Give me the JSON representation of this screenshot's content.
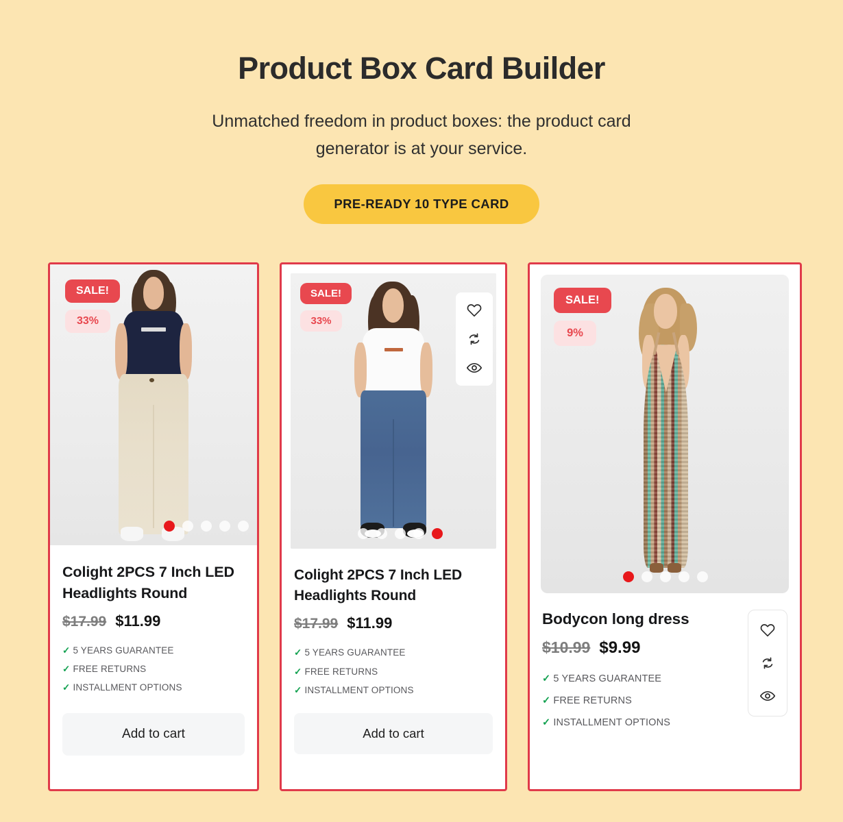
{
  "hero": {
    "title": "Product Box Card Builder",
    "subtitle": "Unmatched freedom in product boxes: the product card generator is at your service.",
    "cta_label": "PRE-READY 10 TYPE CARD",
    "cta_color": "#F9C740",
    "background_color": "#FCE5B2"
  },
  "theme": {
    "card_border_color": "#E03A4A",
    "sale_badge_bg": "#E8484F",
    "sale_badge_text": "#FFFFFF",
    "percent_badge_bg": "#FCE1E2",
    "percent_badge_text": "#E8484F",
    "tick_color": "#12A150",
    "active_dot_color": "#E8181B",
    "cart_button_bg": "#F5F6F7"
  },
  "icons": {
    "wishlist": "heart-icon",
    "compare": "compare-refresh-icon",
    "quickview": "eye-icon"
  },
  "cards": [
    {
      "id": "card-1",
      "sale_badge": "SALE!",
      "discount_badge": "33%",
      "title": "Colight 2PCS 7 Inch LED Headlights Round",
      "price_old": "$17.99",
      "price_new": "$11.99",
      "features": [
        "5 YEARS GUARANTEE",
        "FREE RETURNS",
        "INSTALLMENT OPTIONS"
      ],
      "cart_label": "Add to cart",
      "has_cart_button": true,
      "has_icon_rail": false,
      "dots": {
        "count": 5,
        "active_index": 0
      }
    },
    {
      "id": "card-2",
      "sale_badge": "SALE!",
      "discount_badge": "33%",
      "title": "Colight 2PCS 7 Inch LED Headlights Round",
      "price_old": "$17.99",
      "price_new": "$11.99",
      "features": [
        "5 YEARS GUARANTEE",
        "FREE RETURNS",
        "INSTALLMENT OPTIONS"
      ],
      "cart_label": "Add to cart",
      "has_cart_button": true,
      "has_icon_rail": true,
      "dots": {
        "count": 5,
        "active_index": 4
      }
    },
    {
      "id": "card-3",
      "sale_badge": "SALE!",
      "discount_badge": "9%",
      "title": "Bodycon long dress",
      "price_old": "$10.99",
      "price_new": "$9.99",
      "features": [
        "5 YEARS GUARANTEE",
        "FREE RETURNS",
        "INSTALLMENT OPTIONS"
      ],
      "cart_label": "",
      "has_cart_button": false,
      "has_icon_rail": true,
      "dots": {
        "count": 5,
        "active_index": 0
      }
    }
  ]
}
